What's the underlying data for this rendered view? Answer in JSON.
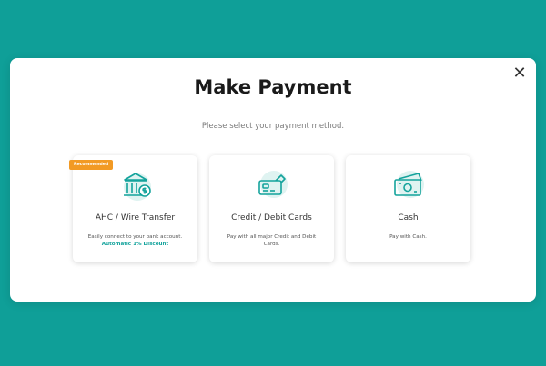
{
  "modal": {
    "title": "Make Payment",
    "subtitle": "Please select your payment method.",
    "close_label": "✕"
  },
  "cards": [
    {
      "icon": "bank-icon",
      "badge": "Recommended",
      "title": "AHC / Wire Transfer",
      "desc": "Easily connect to your bank account.",
      "desc_highlight": "Automatic 1% Discount"
    },
    {
      "icon": "credit-card-icon",
      "title": "Credit / Debit Cards",
      "desc": "Pay with all major Credit and Debit Cards."
    },
    {
      "icon": "cash-icon",
      "title": "Cash",
      "desc": "Pay with Cash."
    }
  ],
  "colors": {
    "background": "#0f9f98",
    "accent": "#14a39c",
    "badge": "#f29a24"
  }
}
